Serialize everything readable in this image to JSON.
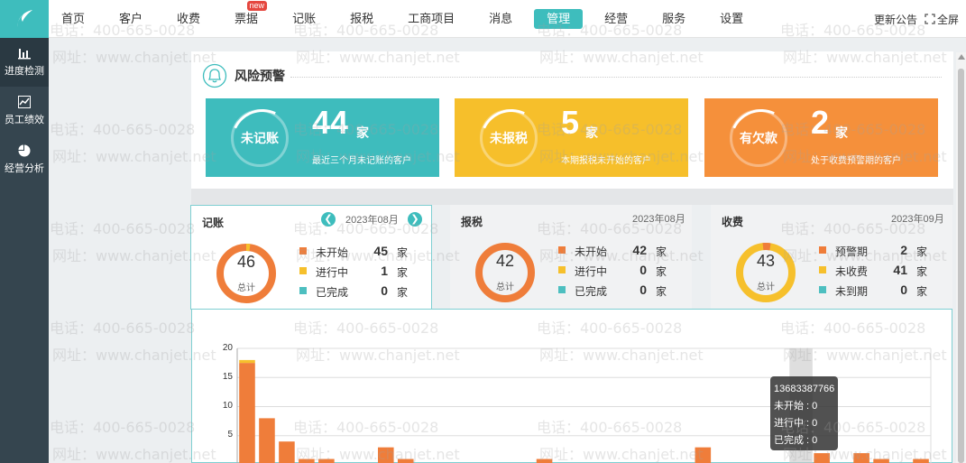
{
  "nav": {
    "items": [
      "首页",
      "客户",
      "收费",
      "票据",
      "记账",
      "报税",
      "工商项目",
      "消息",
      "管理",
      "经营",
      "服务",
      "设置"
    ],
    "active_index": 8,
    "badge_new": "new",
    "right_announce": "更新公告",
    "right_fullscreen": "全屏"
  },
  "sidebar": {
    "items": [
      {
        "label": "进度检测",
        "icon": "bar-chart-icon"
      },
      {
        "label": "员工绩效",
        "icon": "line-chart-icon"
      },
      {
        "label": "经营分析",
        "icon": "pie-chart-icon"
      }
    ]
  },
  "risk": {
    "title": "风险预警",
    "cards": [
      {
        "name": "未记账",
        "count": "44",
        "unit": "家",
        "desc": "最近三个月未记账的客户",
        "color": "#3ebcbd"
      },
      {
        "name": "未报税",
        "count": "5",
        "unit": "家",
        "desc": "本期报税未开始的客户",
        "color": "#f6bf2b"
      },
      {
        "name": "有欠款",
        "count": "2",
        "unit": "家",
        "desc": "处于收费预警期的客户",
        "color": "#f5903b"
      }
    ]
  },
  "stats": {
    "jizhang": {
      "title": "记账",
      "date": "2023年08月",
      "total": "46",
      "total_label": "总计",
      "rows": [
        {
          "name": "未开始",
          "count": "45",
          "unit": "家",
          "color": "#ef7d3a"
        },
        {
          "name": "进行中",
          "count": "1",
          "unit": "家",
          "color": "#f6c02c"
        },
        {
          "name": "已完成",
          "count": "0",
          "unit": "家",
          "color": "#4dbfc0"
        }
      ]
    },
    "baoshui": {
      "title": "报税",
      "date": "2023年08月",
      "total": "42",
      "total_label": "总计",
      "rows": [
        {
          "name": "未开始",
          "count": "42",
          "unit": "家",
          "color": "#ef7d3a"
        },
        {
          "name": "进行中",
          "count": "0",
          "unit": "家",
          "color": "#f6c02c"
        },
        {
          "name": "已完成",
          "count": "0",
          "unit": "家",
          "color": "#4dbfc0"
        }
      ]
    },
    "shoufei": {
      "title": "收费",
      "date": "2023年09月",
      "total": "43",
      "total_label": "总计",
      "rows": [
        {
          "name": "预警期",
          "count": "2",
          "unit": "家",
          "color": "#ef7d3a"
        },
        {
          "name": "未收费",
          "count": "41",
          "unit": "家",
          "color": "#f6c02c"
        },
        {
          "name": "未到期",
          "count": "0",
          "unit": "家",
          "color": "#4dbfc0"
        }
      ]
    }
  },
  "chart_data": {
    "type": "bar",
    "ylim": [
      0,
      20
    ],
    "yticks": [
      "20",
      "15",
      "10",
      "5"
    ],
    "grid": true,
    "series": [
      {
        "values": [
          17.5,
          8,
          4,
          1,
          1,
          0,
          0,
          3,
          1,
          0,
          0,
          0,
          0,
          0,
          0,
          1,
          0,
          0,
          0,
          0,
          0,
          0,
          0,
          3,
          0,
          0,
          0,
          0,
          0,
          2,
          0,
          2,
          1,
          0,
          1
        ],
        "color": "#ef7d3a"
      },
      {
        "values": [
          0.5,
          0,
          0,
          0,
          0,
          0,
          0,
          0,
          0,
          0,
          0,
          0,
          0,
          0,
          0,
          0,
          0,
          0,
          0,
          0,
          0,
          0,
          0,
          0,
          0,
          0,
          0,
          0,
          0,
          0,
          0,
          0,
          0,
          0,
          0
        ],
        "color": "#f6c02c"
      }
    ],
    "highlight_index": 28
  },
  "tooltip": {
    "title": "13683387766",
    "lines": [
      "未开始 : 0",
      "进行中 : 0",
      "已完成 : 0"
    ]
  },
  "watermark": {
    "phone": "电话：400-665-0028",
    "site": "网址：www.chanjet.net"
  }
}
